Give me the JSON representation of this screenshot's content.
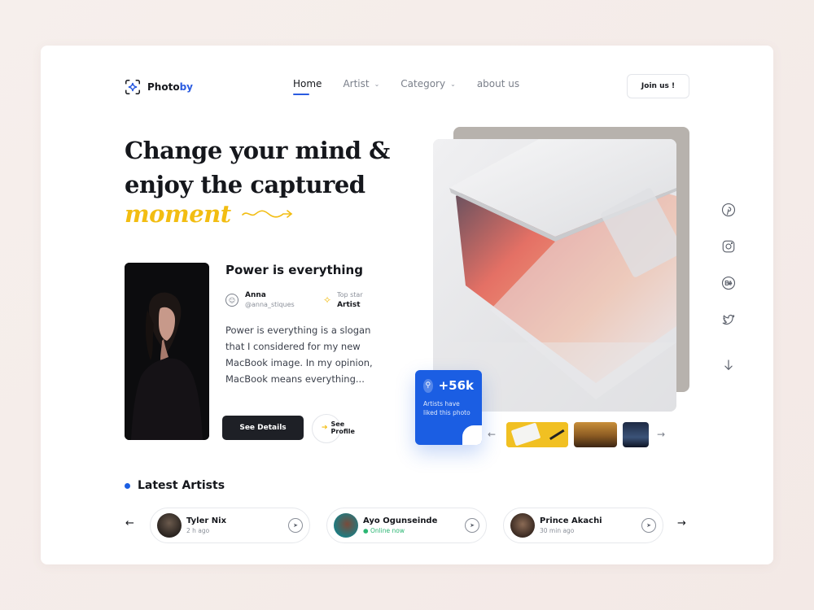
{
  "brand": {
    "name_main": "Photo",
    "name_accent": "by",
    "accent_color": "#2a5be0",
    "logo_icon": "focus-sparkle-icon"
  },
  "nav": {
    "items": [
      {
        "label": "Home",
        "active": true
      },
      {
        "label": "Artist",
        "dropdown": true
      },
      {
        "label": "Category",
        "dropdown": true
      },
      {
        "label": "about us"
      }
    ],
    "join_label": "Join us !"
  },
  "hero": {
    "line1": "Change your mind &",
    "line2": "enjoy the captured",
    "highlight": "moment",
    "highlight_color": "#f2bd12"
  },
  "featured": {
    "title": "Power is everything",
    "author_name": "Anna",
    "author_handle": "@anna_stiques",
    "badge_label": "Top star",
    "badge_value": "Artist",
    "body": "Power is everything is a slogan that I considered for my new MacBook image. In my opinion, MacBook means everything...",
    "primary_button": "See Details",
    "secondary_button": "See Profile"
  },
  "stat": {
    "value": "+56k",
    "description": "Artists have liked this photo",
    "color": "#1b5ee3"
  },
  "social": [
    "pinterest-icon",
    "instagram-icon",
    "behance-icon",
    "twitter-icon",
    "arrow-down-icon"
  ],
  "latest": {
    "title": "Latest Artists",
    "artists": [
      {
        "name": "Tyler Nix",
        "status": "2 h ago",
        "online": false
      },
      {
        "name": "Ayo Ogunseinde",
        "status": "Online now",
        "online": true
      },
      {
        "name": "Prince Akachi",
        "status": "30 min ago",
        "online": false
      }
    ]
  }
}
